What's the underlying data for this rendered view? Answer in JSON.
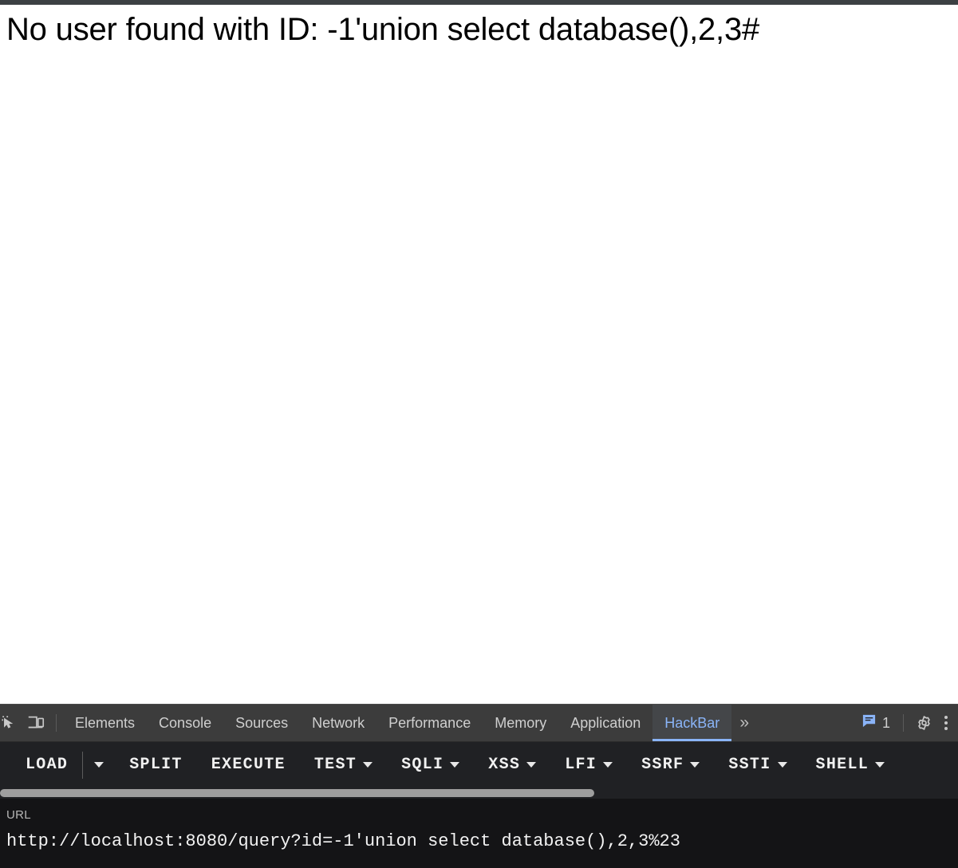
{
  "page": {
    "message": "No user found with ID: -1'union select database(),2,3#"
  },
  "devtools": {
    "left_tools": [
      {
        "name": "inspect-element-icon",
        "label": "Inspect element"
      },
      {
        "name": "device-toolbar-icon",
        "label": "Toggle device toolbar"
      }
    ],
    "tabs": [
      {
        "label": "Elements",
        "active": false
      },
      {
        "label": "Console",
        "active": false
      },
      {
        "label": "Sources",
        "active": false
      },
      {
        "label": "Network",
        "active": false
      },
      {
        "label": "Performance",
        "active": false
      },
      {
        "label": "Memory",
        "active": false
      },
      {
        "label": "Application",
        "active": false
      },
      {
        "label": "HackBar",
        "active": true
      }
    ],
    "overflow_label": "»",
    "issues": {
      "icon": "issues-message-icon",
      "count": "1"
    },
    "settings_icon": "gear-icon",
    "more_icon": "kebab-menu-icon"
  },
  "hackbar": {
    "buttons": [
      {
        "label": "LOAD",
        "caret": false
      },
      {
        "label": "",
        "caret": true,
        "caret_only": true
      },
      {
        "label": "SPLIT",
        "caret": false
      },
      {
        "label": "EXECUTE",
        "caret": false
      },
      {
        "label": "TEST",
        "caret": true
      },
      {
        "label": "SQLI",
        "caret": true
      },
      {
        "label": "XSS",
        "caret": true
      },
      {
        "label": "LFI",
        "caret": true
      },
      {
        "label": "SSRF",
        "caret": true
      },
      {
        "label": "SSTI",
        "caret": true
      },
      {
        "label": "SHELL",
        "caret": true
      }
    ],
    "url_label": "URL",
    "url_value": "http://localhost:8080/query?id=-1'union select database(),2,3%23"
  },
  "colors": {
    "accent_blue": "#8ab4f8",
    "tabbar_bg": "#3c3c3c",
    "toolbar_bg": "#202124",
    "url_panel_bg": "#141416"
  }
}
